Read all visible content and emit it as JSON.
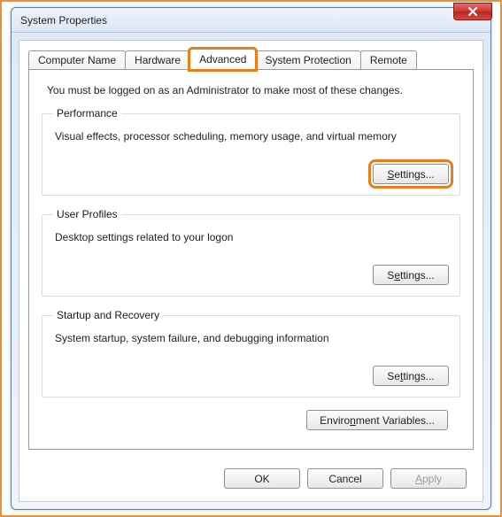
{
  "window": {
    "title": "System Properties"
  },
  "tabs": {
    "computer_name": "Computer Name",
    "hardware": "Hardware",
    "advanced": "Advanced",
    "system_protection": "System Protection",
    "remote": "Remote"
  },
  "page": {
    "admin_note": "You must be logged on as an Administrator to make most of these changes."
  },
  "performance": {
    "legend": "Performance",
    "desc": "Visual effects, processor scheduling, memory usage, and virtual memory",
    "settings_btn": "Settings..."
  },
  "user_profiles": {
    "legend": "User Profiles",
    "desc": "Desktop settings related to your logon",
    "settings_btn": "Settings..."
  },
  "startup": {
    "legend": "Startup and Recovery",
    "desc": "System startup, system failure, and debugging information",
    "settings_btn": "Settings..."
  },
  "env_btn": "Environment Variables...",
  "buttons": {
    "ok": "OK",
    "cancel": "Cancel",
    "apply": "Apply"
  },
  "highlight": {
    "color": "#ec7c1a"
  }
}
